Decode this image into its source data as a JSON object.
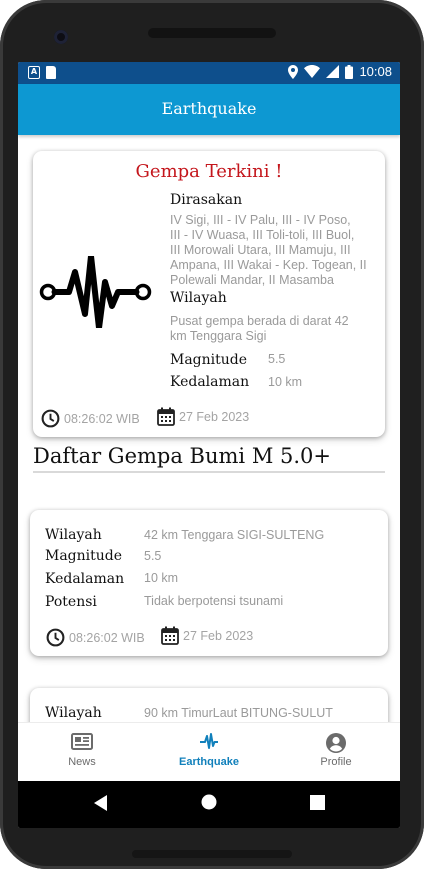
{
  "status_bar": {
    "time": "10:08",
    "app_icon_letter": "A"
  },
  "app_bar": {
    "title": "Earthquake"
  },
  "latest": {
    "heading": "Gempa Terkini !",
    "felt_label": "Dirasakan",
    "felt_lines": [
      "IV Sigi, III - IV Palu, III - IV Poso,",
      "III - IV Wuasa, III Toli-toli, III Buol,",
      "III Morowali Utara, III Mamuju, III",
      "Ampana, III Wakai - Kep. Togean, II",
      "Polewali Mandar, II Masamba"
    ],
    "region_label": "Wilayah",
    "region_lines": [
      "Pusat gempa berada di darat 42",
      "km Tenggara Sigi"
    ],
    "magnitude_label": "Magnitude",
    "magnitude": "5.5",
    "depth_label": "Kedalaman",
    "depth": "10 km",
    "time": "08:26:02 WIB",
    "date": "27 Feb 2023",
    "logo_icon": "seismograph-icon"
  },
  "list_title": "Daftar Gempa Bumi M 5.0+",
  "list": [
    {
      "region_label": "Wilayah",
      "region": "42 km Tenggara SIGI-SULTENG",
      "magnitude_label": "Magnitude",
      "magnitude": "5.5",
      "depth_label": "Kedalaman",
      "depth": "10 km",
      "potential_label": "Potensi",
      "potential": "Tidak berpotensi tsunami",
      "time": "08:26:02 WIB",
      "date": "27 Feb 2023"
    },
    {
      "region_label": "Wilayah",
      "region": "90 km TimurLaut BITUNG-SULUT"
    }
  ],
  "bottom_nav": [
    {
      "label": "News",
      "icon": "newspaper-icon",
      "active": false
    },
    {
      "label": "Earthquake",
      "icon": "pulse-icon",
      "active": true
    },
    {
      "label": "Profile",
      "icon": "account-circle-icon",
      "active": false
    }
  ],
  "colors": {
    "app_bar": "#0d98d2",
    "status_bar": "#0e4f8c",
    "heading_red": "#c4161c",
    "active_nav": "#1180bb"
  }
}
